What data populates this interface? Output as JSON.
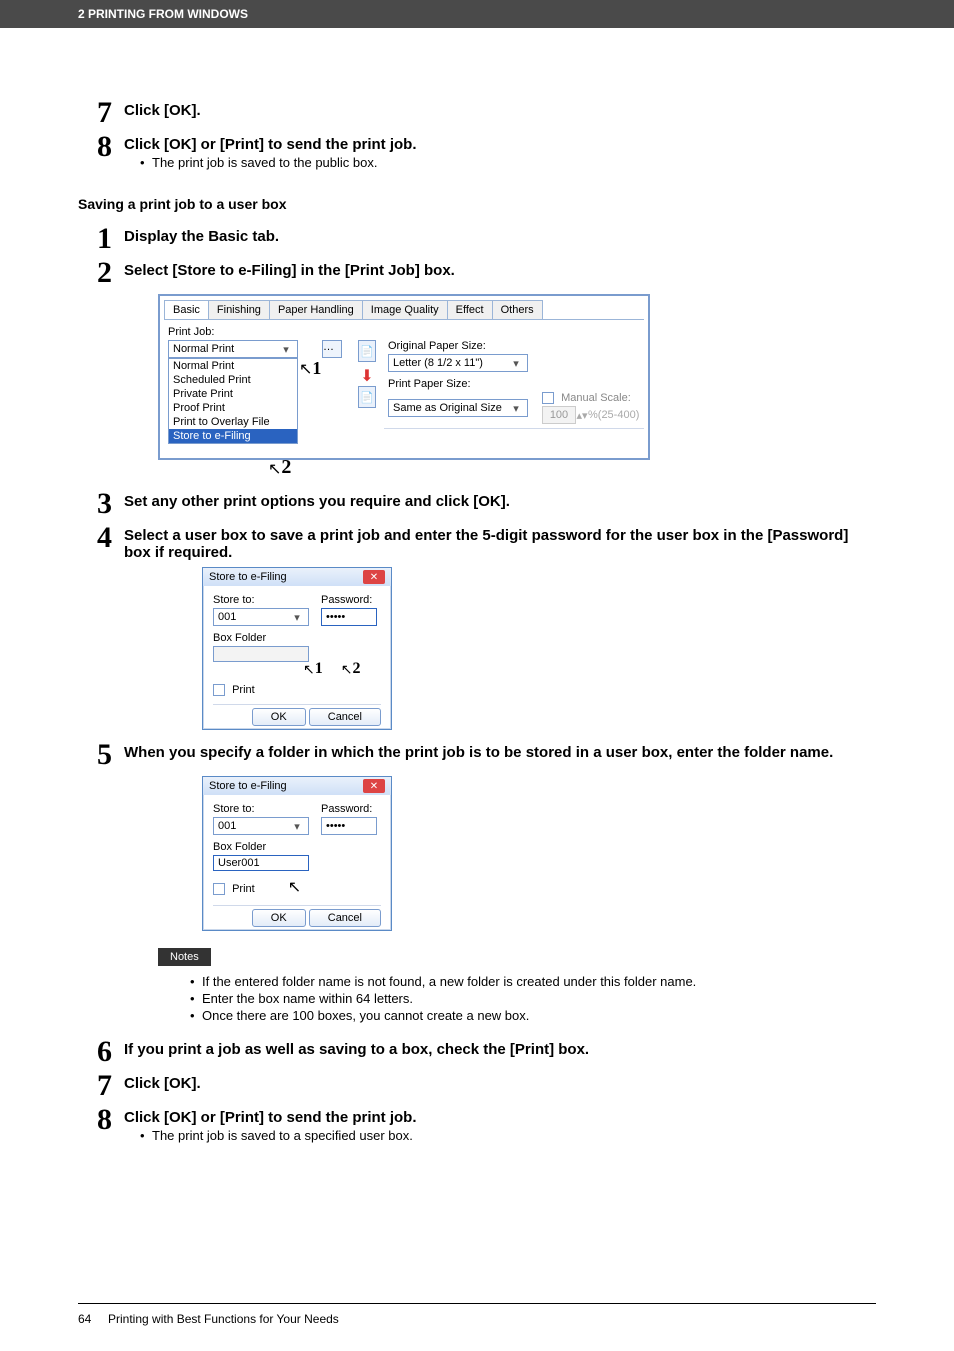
{
  "header": {
    "chapter": "2 PRINTING FROM WINDOWS"
  },
  "section1": {
    "step7": {
      "title": "Click [OK]."
    },
    "step8": {
      "title": "Click [OK] or [Print] to send the print job.",
      "bullet": "The print job is saved to the public box."
    }
  },
  "heading2": "Saving a print job to a user box",
  "section2": {
    "step1": {
      "title": "Display the Basic tab."
    },
    "step2": {
      "title": "Select [Store to e-Filing] in the [Print Job] box."
    },
    "step3": {
      "title": "Set any other print options you require and click [OK]."
    },
    "step4": {
      "title": "Select a user box to save a print job and enter the 5-digit password for the user box in the [Password] box if required."
    },
    "step5": {
      "title": "When you specify a folder in which the print job is to be stored in a user box, enter the folder name."
    },
    "step6": {
      "title": "If you print a job as well as saving to a box, check the [Print] box."
    },
    "step7": {
      "title": "Click [OK]."
    },
    "step8": {
      "title": "Click [OK] or [Print] to send the print job.",
      "bullet": "The print job is saved to a specified user box."
    }
  },
  "tabs_dialog": {
    "tabs": [
      "Basic",
      "Finishing",
      "Paper Handling",
      "Image Quality",
      "Effect",
      "Others"
    ],
    "print_job_label": "Print Job:",
    "combo_value": "Normal Print",
    "options": [
      "Normal Print",
      "Scheduled Print",
      "Private Print",
      "Proof Print",
      "Print to Overlay File",
      "Store to e-Filing"
    ],
    "orig_size_label": "Original Paper Size:",
    "orig_size_value": "Letter (8 1/2 x 11\")",
    "print_size_label": "Print Paper Size:",
    "print_size_value": "Same as Original Size",
    "manual_scale_label": "Manual Scale:",
    "manual_scale_value": "100",
    "manual_scale_range": "%(25-400)",
    "callout1": "1",
    "callout2": "2"
  },
  "small_dialog": {
    "title": "Store to e-Filing",
    "store_to_label": "Store to:",
    "store_to_value": "001",
    "password_label": "Password:",
    "password_value": "•••••",
    "box_folder_label": "Box Folder",
    "box_folder_value_step5": "User001",
    "print_label": "Print",
    "ok": "OK",
    "cancel": "Cancel",
    "callout1": "1",
    "callout2": "2"
  },
  "notes": {
    "label": "Notes",
    "items": [
      "If the entered folder name is not found, a new folder is created under this folder name.",
      "Enter the box name within 64 letters.",
      "Once there are 100 boxes, you cannot create a new box."
    ]
  },
  "footer": {
    "page": "64",
    "title": "Printing with Best Functions for Your Needs"
  }
}
